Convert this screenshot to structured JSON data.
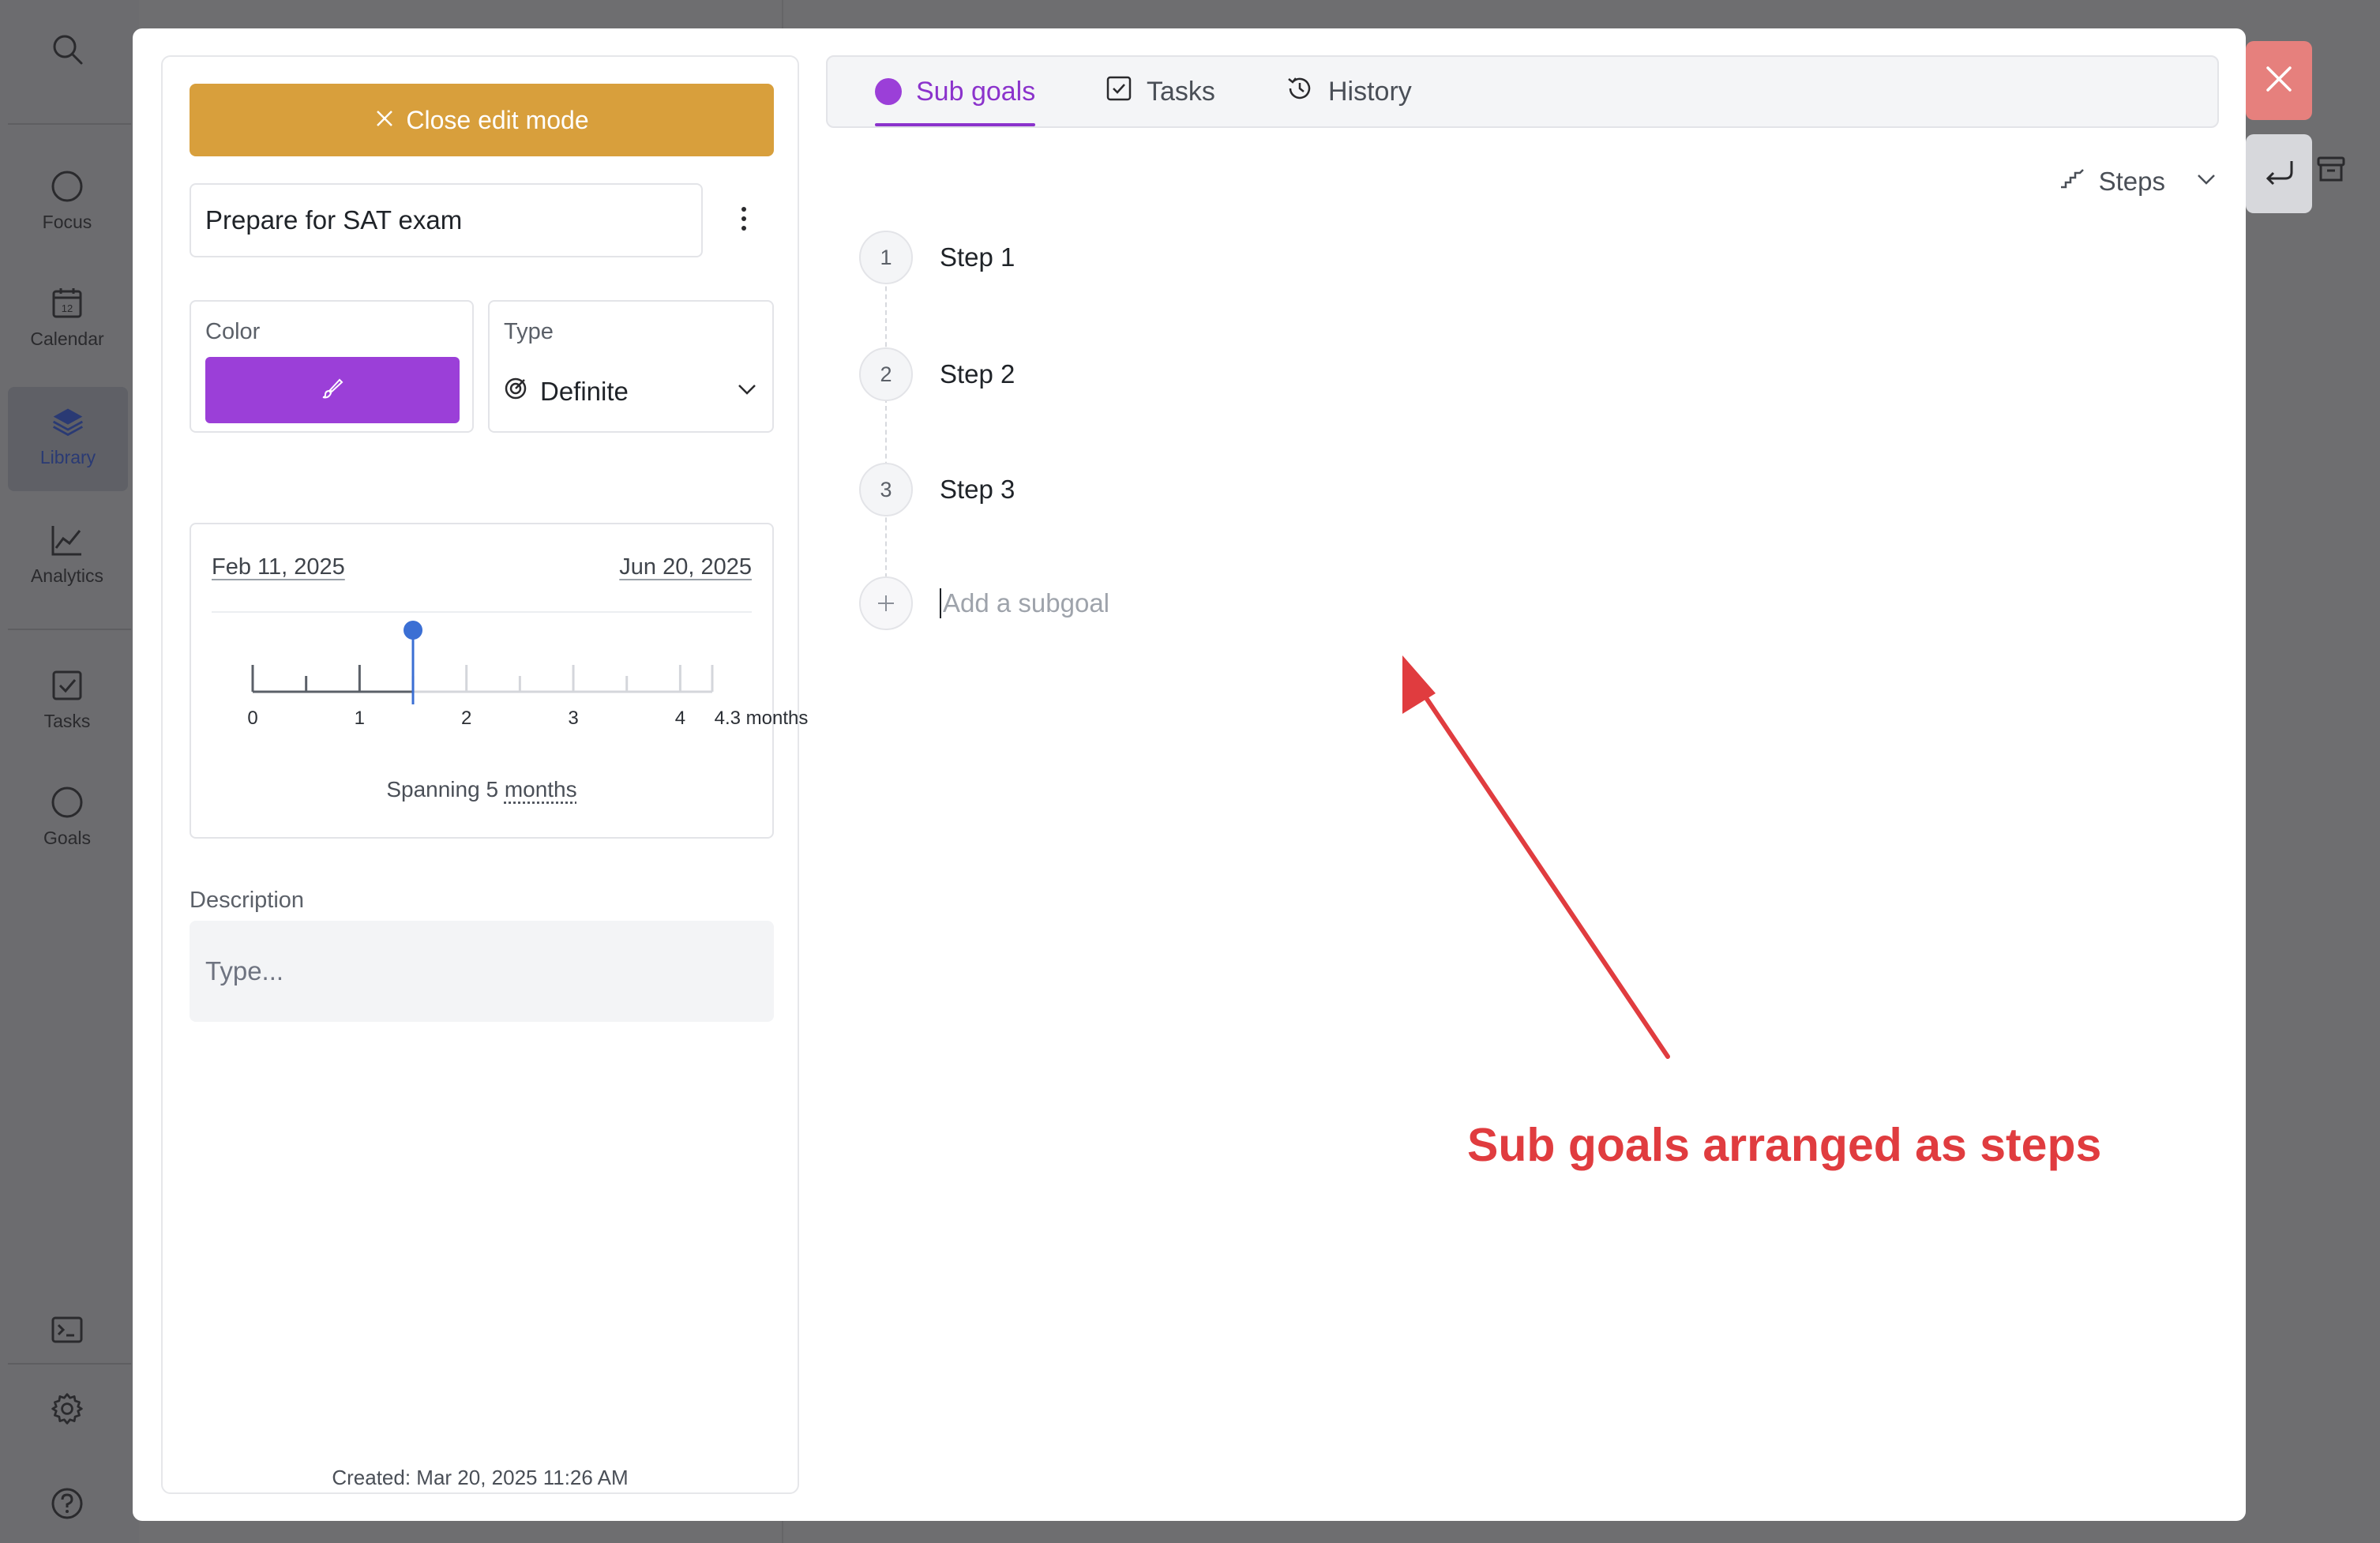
{
  "sidebar": {
    "items": [
      {
        "label": "",
        "icon": "search-icon"
      },
      {
        "label": "Focus",
        "icon": "circle-icon"
      },
      {
        "label": "Calendar",
        "icon": "calendar-icon",
        "badge": "12"
      },
      {
        "label": "Library",
        "icon": "layers-icon",
        "active": true
      },
      {
        "label": "Analytics",
        "icon": "chart-icon"
      },
      {
        "label": "Tasks",
        "icon": "checkbox-icon"
      },
      {
        "label": "Goals",
        "icon": "circle-icon"
      }
    ],
    "bottom_icons": [
      "terminal-icon",
      "gear-icon",
      "help-icon"
    ]
  },
  "modal": {
    "close_edit_label": "Close edit mode",
    "goal_title": "Prepare for SAT exam",
    "color_label": "Color",
    "color_value": "#9b3fd8",
    "type_label": "Type",
    "type_value": "Definite",
    "timeline": {
      "start_date": "Feb 11, 2025",
      "end_date": "Jun 20, 2025",
      "tick_labels": [
        "0",
        "1",
        "2",
        "3",
        "4",
        "4.3 months"
      ],
      "current_months": 1.5,
      "total_months": 4.3,
      "spanning_prefix": "Spanning 5",
      "spanning_unit": "months"
    },
    "description_label": "Description",
    "description_placeholder": "Type...",
    "created": "Created: Mar 20, 2025 11:26 AM",
    "tabs": [
      {
        "label": "Sub goals",
        "active": true
      },
      {
        "label": "Tasks",
        "active": false
      },
      {
        "label": "History",
        "active": false
      }
    ],
    "view_mode": "Steps",
    "steps": [
      {
        "number": "1",
        "label": "Step 1"
      },
      {
        "number": "2",
        "label": "Step 2"
      },
      {
        "number": "3",
        "label": "Step 3"
      }
    ],
    "add_subgoal_placeholder": "Add a subgoal"
  },
  "annotation": {
    "text": "Sub goals arranged as steps",
    "color": "#e03c3f"
  },
  "colors": {
    "accent_purple": "#8b33cc",
    "close_button": "#d89f3c",
    "timeline_marker": "#3b6fd4"
  }
}
